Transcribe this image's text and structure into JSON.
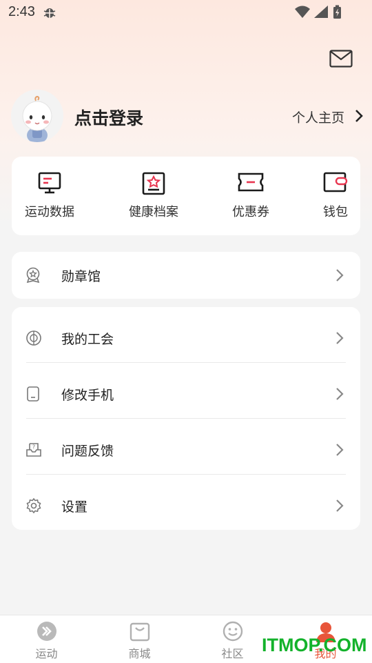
{
  "status_bar": {
    "time": "2:43"
  },
  "header": {
    "login_text": "点击登录",
    "homepage_label": "个人主页"
  },
  "quick_actions": [
    {
      "label": "运动数据",
      "icon": "monitor-icon"
    },
    {
      "label": "健康档案",
      "icon": "health-record-icon"
    },
    {
      "label": "优惠券",
      "icon": "coupon-icon"
    },
    {
      "label": "钱包",
      "icon": "wallet-icon"
    }
  ],
  "medal_section": {
    "label": "勋章馆",
    "icon": "medal-icon"
  },
  "menu": [
    {
      "label": "我的工会",
      "icon": "union-icon"
    },
    {
      "label": "修改手机",
      "icon": "phone-icon"
    },
    {
      "label": "问题反馈",
      "icon": "feedback-icon"
    },
    {
      "label": "设置",
      "icon": "settings-icon"
    }
  ],
  "tab_bar": [
    {
      "label": "运动",
      "icon": "sport-icon",
      "active": false
    },
    {
      "label": "商城",
      "icon": "mall-bag-icon",
      "active": false
    },
    {
      "label": "社区",
      "icon": "community-smile-icon",
      "active": false
    },
    {
      "label": "我的",
      "icon": "profile-icon",
      "active": true
    }
  ],
  "watermark": "ITMOP.COM",
  "colors": {
    "accent": "#e8553a",
    "icon_dark": "#1a1a1a",
    "icon_red": "#e8354f",
    "background": "#f4f4f4"
  }
}
